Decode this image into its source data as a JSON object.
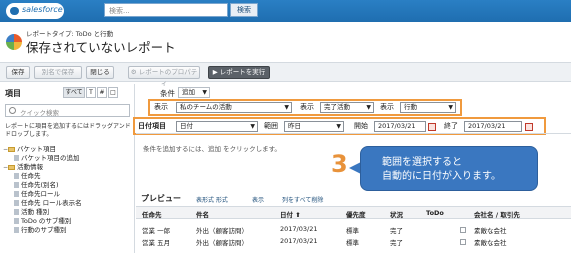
{
  "header": {
    "logo_text": "salesforce",
    "search_placeholder": "検索...",
    "search_button": "検索"
  },
  "report": {
    "type_label": "レポートタイプ: ToDo と行動",
    "title": "保存されていないレポート"
  },
  "toolbar": {
    "save": "保存",
    "save_as": "別名で保存",
    "close": "閉じる",
    "properties": "レポートのプロパティ",
    "run": "レポートを実行"
  },
  "left_panel": {
    "title": "項目",
    "view_all": "すべて",
    "view_text": "T",
    "view_num": "#",
    "view_other": "□",
    "search_placeholder": "クイック検索",
    "hint": "レポートに項目を追加するにはドラッグアンドドロップします。",
    "tree": [
      {
        "label": "バケット項目",
        "kind": "folder",
        "indent": 0
      },
      {
        "label": "バケット項目の追加",
        "kind": "field",
        "indent": 1
      },
      {
        "label": "活動情報",
        "kind": "folder",
        "indent": 0
      },
      {
        "label": "任命先",
        "kind": "field",
        "indent": 1
      },
      {
        "label": "任命先(別名)",
        "kind": "field",
        "indent": 1
      },
      {
        "label": "任命先ロール",
        "kind": "field",
        "indent": 1
      },
      {
        "label": "任命先 ロール表示名",
        "kind": "field",
        "indent": 1
      },
      {
        "label": "活動 種別",
        "kind": "field",
        "indent": 1
      },
      {
        "label": "ToDo のサブ種別",
        "kind": "field",
        "indent": 1
      },
      {
        "label": "行動のサブ種別",
        "kind": "field",
        "indent": 1
      }
    ]
  },
  "filters": {
    "conditions_label": "条件",
    "add_label": "追加",
    "show1_label": "表示",
    "show1_value": "私のチームの活動",
    "show2_label": "表示",
    "show2_value": "完了活動",
    "show3_label": "表示",
    "show3_value": "行動",
    "date_field_label": "日付項目",
    "date_field_value": "日付",
    "range_label": "範囲",
    "range_value": "昨日",
    "start_label": "開始",
    "start_value": "2017/03/21",
    "end_label": "終了",
    "end_value": "2017/03/21",
    "condition_hint": "条件を追加するには、追加 をクリックします。"
  },
  "annotation": {
    "step_number": "3",
    "callout_line1": "範囲を選択すると",
    "callout_line2": "自動的に日付が入ります。"
  },
  "preview": {
    "title": "プレビュー",
    "format_label": "表形式 形式",
    "show_label": "表示",
    "remove_cols": "列をすべて削除",
    "columns": [
      "任命先",
      "件名",
      "日付",
      "優先度",
      "状況",
      "ToDo",
      "会社名 / 取引先"
    ],
    "rows": [
      [
        "営業 一郎",
        "外出（顧客訪問）",
        "2017/03/21",
        "標準",
        "完了",
        "",
        "素敵な会社"
      ],
      [
        "営業 五月",
        "外出（顧客訪問）",
        "2017/03/21",
        "標準",
        "完了",
        "",
        "素敵な会社"
      ]
    ]
  },
  "colors": {
    "header_blue": "#1f6eb0",
    "highlight_orange": "#f09a3e",
    "callout_blue": "#3a77c0",
    "step_number_orange": "#e8923a"
  }
}
